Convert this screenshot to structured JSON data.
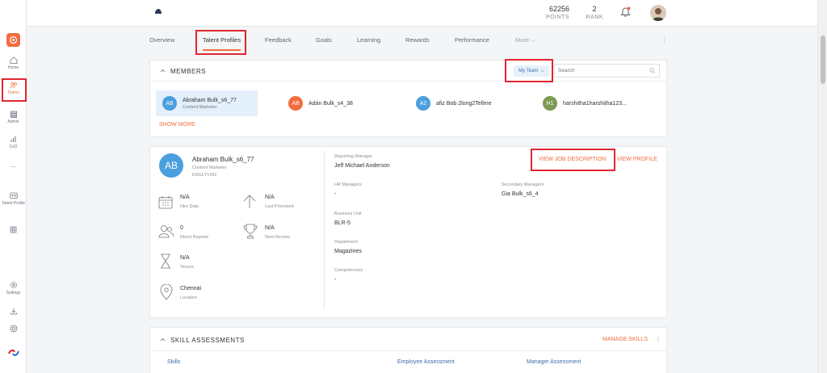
{
  "topbar": {
    "points": {
      "value": "62256",
      "label": "POINTS"
    },
    "rank": {
      "value": "2",
      "label": "RANK"
    }
  },
  "sidebar": {
    "items": [
      {
        "label": "Home"
      },
      {
        "label": "Teams"
      },
      {
        "label": "Admin"
      },
      {
        "label": "CxO"
      },
      {
        "label": "..."
      },
      {
        "label": "Talent Profile"
      },
      {
        "label": "Settings"
      }
    ]
  },
  "tabs": [
    "Overview",
    "Talent Profiles",
    "Feedback",
    "Goals",
    "Learning",
    "Rewards",
    "Performance",
    "More"
  ],
  "members": {
    "title": "MEMBERS",
    "filter_label": "My Team",
    "search_placeholder": "Search",
    "show_more": "SHOW MORE",
    "list": [
      {
        "initials": "AB",
        "name": "Abraham Bulk_s6_77",
        "role": "Content Marketer",
        "color": "#4a9fde"
      },
      {
        "initials": "AB",
        "name": "Adán Bulk_s4_38",
        "role": "",
        "color": "#f26c3f"
      },
      {
        "initials": "A2",
        "name": "afiz Bob 2long2Tellme",
        "role": "",
        "color": "#4a9fde"
      },
      {
        "initials": "H1",
        "name": "harshitha1harshitha123...",
        "role": "",
        "color": "#7d9b54"
      }
    ]
  },
  "profile": {
    "initials": "AB",
    "name": "Abraham Bulk_s6_77",
    "role": "Content Marketer",
    "id": "ENGLY1492",
    "stats": [
      {
        "value": "N/A",
        "label": "Hire Date"
      },
      {
        "value": "N/A",
        "label": "Last Promoted"
      },
      {
        "value": "0",
        "label": "Direct Reports"
      },
      {
        "value": "N/A",
        "label": "Next Review"
      },
      {
        "value": "N/A",
        "label": "Tenure"
      },
      {
        "value": "Chennai",
        "label": "Location"
      }
    ],
    "view_job_description": "VIEW JOB DESCRIPTION",
    "view_profile": "VIEW PROFILE",
    "reporting_manager": {
      "label": "Reporting Manager",
      "value": "Jeff Michael Anderson"
    },
    "hr_managers": {
      "label": "HR Managers",
      "value": "-"
    },
    "secondary_managers": {
      "label": "Secondary Managers",
      "value": "Gia Bulk_s6_4"
    },
    "business_unit": {
      "label": "Business Unit",
      "value": "BLR-5"
    },
    "department": {
      "label": "Department",
      "value": "Magazines"
    },
    "competencies": {
      "label": "Competencies",
      "value": "-"
    }
  },
  "skills": {
    "title": "SKILL ASSESSMENTS",
    "manage": "MANAGE SKILLS",
    "columns": [
      "Skills",
      "Employee Assessment",
      "Manager Assessment"
    ]
  },
  "colors": {
    "accent": "#f26c3f",
    "highlight": "#e0262f"
  }
}
